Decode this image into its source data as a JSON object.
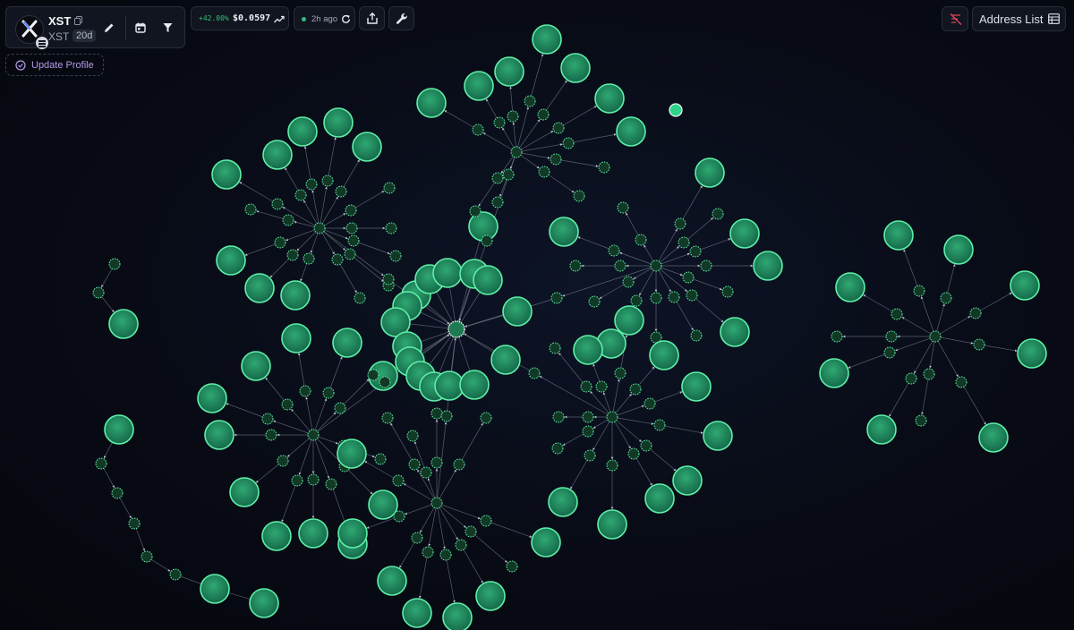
{
  "token": {
    "name": "XST",
    "symbol": "XST",
    "age": "20d"
  },
  "price": {
    "change": "+42.00%",
    "value": "$0.0597"
  },
  "refresh": {
    "time": "2h ago"
  },
  "actions": {
    "update_profile": "Update Profile",
    "address_list": "Address List"
  },
  "icons": {
    "copy": "copy-icon",
    "edit": "pencil-icon",
    "calendar": "calendar-icon",
    "filter": "funnel-icon",
    "chart": "trend-line-icon",
    "refresh": "refresh-icon",
    "share": "share-icon",
    "tools": "wrench-icon",
    "update": "check-circle-icon",
    "hide_links": "link-off-icon",
    "address_list": "table-icon"
  },
  "colors": {
    "background": "#080b15",
    "node_fill": "#1f8a5a",
    "node_stroke": "#5ef0a8",
    "edge": "#9aa2b4",
    "price_up": "#33c07a",
    "accent_purple": "#b39ae8",
    "hide_links_red": "#e0445a"
  }
}
